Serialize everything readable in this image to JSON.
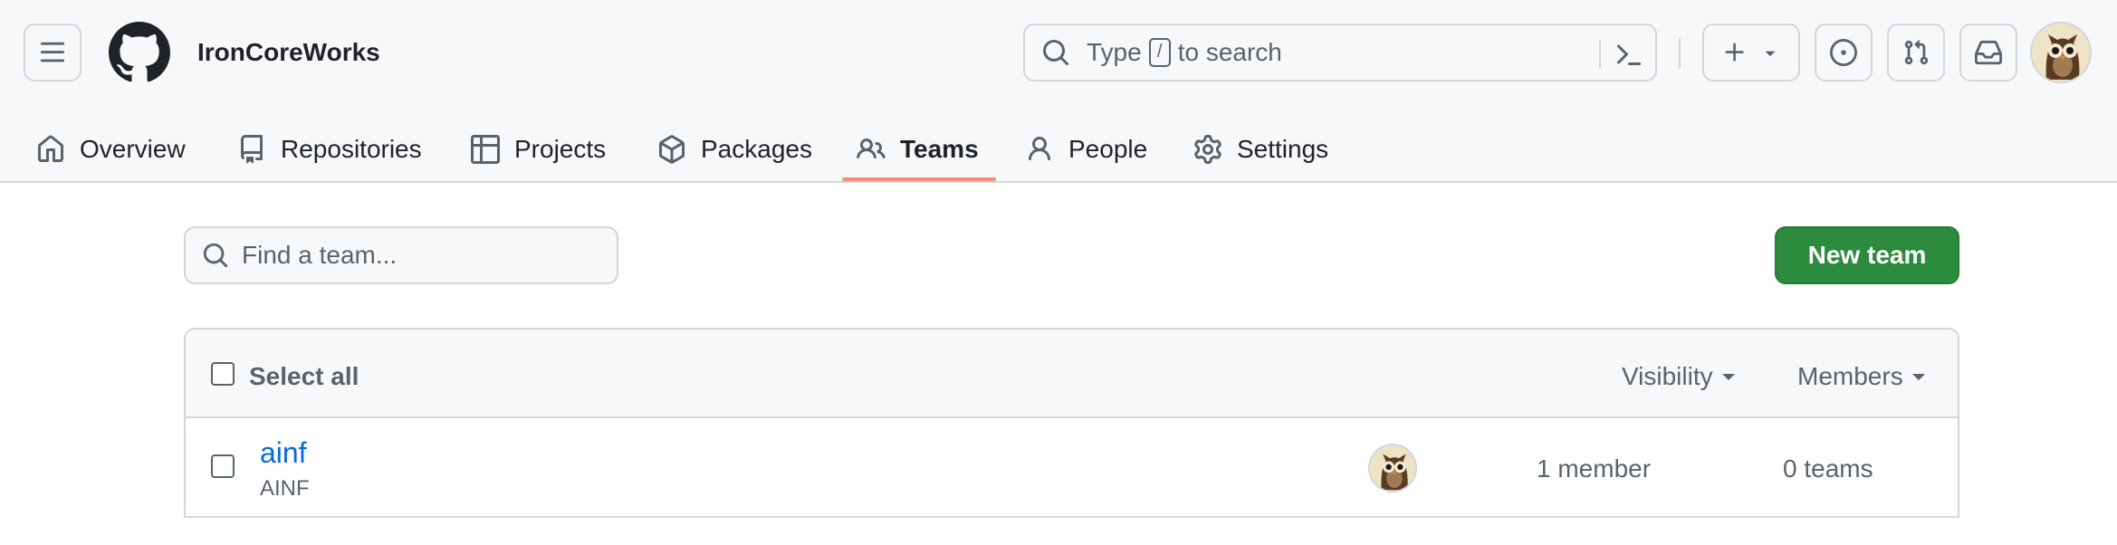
{
  "header": {
    "org_name": "IronCoreWorks",
    "search_prefix": "Type",
    "search_kbd": "/",
    "search_suffix": "to search",
    "icons": [
      "hamburger-menu-icon",
      "github-logo-icon",
      "search-icon",
      "command-palette-icon",
      "plus-icon",
      "chevron-down-icon",
      "issue-icon",
      "pull-request-icon",
      "inbox-icon"
    ]
  },
  "tabs": [
    {
      "label": "Overview",
      "icon": "home-icon",
      "selected": false
    },
    {
      "label": "Repositories",
      "icon": "repo-icon",
      "selected": false
    },
    {
      "label": "Projects",
      "icon": "table-icon",
      "selected": false
    },
    {
      "label": "Packages",
      "icon": "package-icon",
      "selected": false
    },
    {
      "label": "Teams",
      "icon": "people-icon",
      "selected": true
    },
    {
      "label": "People",
      "icon": "person-icon",
      "selected": false
    },
    {
      "label": "Settings",
      "icon": "gear-icon",
      "selected": false
    }
  ],
  "main": {
    "find_placeholder": "Find a team...",
    "new_team_label": "New team",
    "select_all_label": "Select all",
    "visibility_label": "Visibility",
    "members_label": "Members",
    "teams": [
      {
        "name": "ainf",
        "slug": "AINF",
        "member_count": "1 member",
        "team_count": "0 teams"
      }
    ]
  },
  "colors": {
    "accent_link": "#0969da",
    "primary_button": "#2c8b3d",
    "selected_tab_underline": "#fd8c73"
  }
}
